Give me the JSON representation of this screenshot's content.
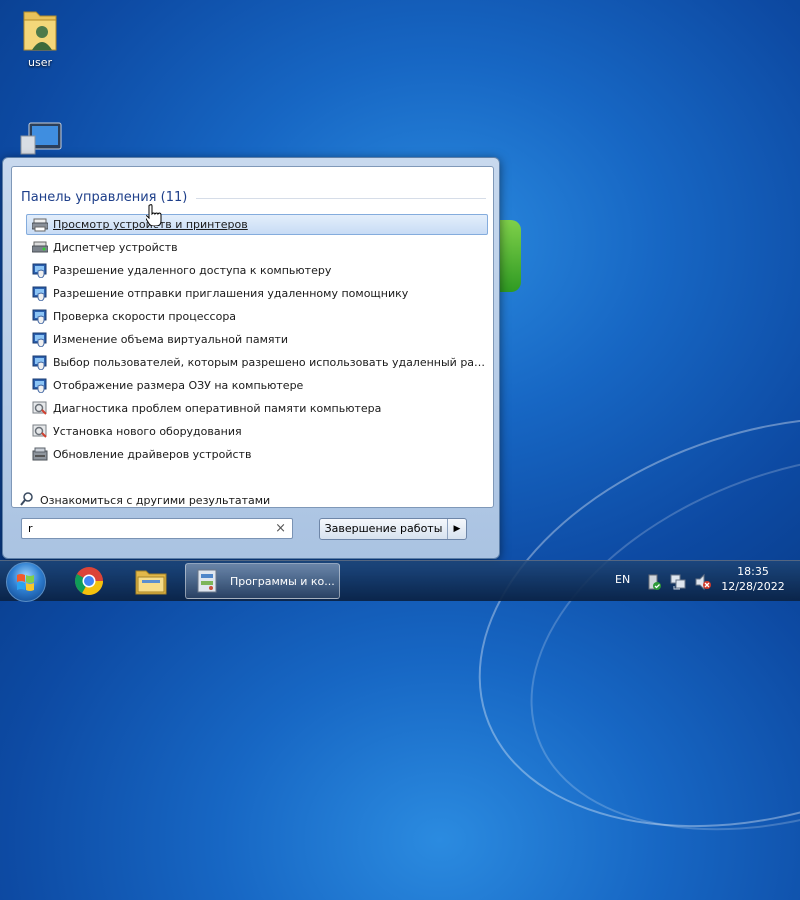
{
  "desktop": {
    "icons": [
      {
        "label": "user",
        "icon": "user-folder-icon"
      },
      {
        "label": "",
        "icon": "computer-icon"
      }
    ]
  },
  "start_menu": {
    "section_title": "Панель управления (11)",
    "items": [
      {
        "label": "Просмотр устройств и принтеров",
        "icon": "devices-printers-icon",
        "highlighted": true
      },
      {
        "label": "Диспетчер устройств",
        "icon": "device-manager-icon"
      },
      {
        "label": "Разрешение удаленного доступа к компьютеру",
        "icon": "system-shield-icon"
      },
      {
        "label": "Разрешение отправки приглашения удаленному помощнику",
        "icon": "system-shield-icon"
      },
      {
        "label": "Проверка скорости процессора",
        "icon": "system-shield-icon"
      },
      {
        "label": "Изменение объема виртуальной памяти",
        "icon": "system-shield-icon"
      },
      {
        "label": "Выбор пользователей, которым разрешено использовать удаленный рабоч...",
        "icon": "system-shield-icon"
      },
      {
        "label": "Отображение размера ОЗУ на компьютере",
        "icon": "system-shield-icon"
      },
      {
        "label": "Диагностика проблем оперативной памяти компьютера",
        "icon": "admin-tools-icon"
      },
      {
        "label": "Установка нового оборудования",
        "icon": "admin-tools-icon"
      },
      {
        "label": "Обновление драйверов устройств",
        "icon": "driver-update-icon"
      }
    ],
    "more_results": "Ознакомиться с другими результатами",
    "search": {
      "value": "r"
    },
    "shutdown_label": "Завершение работы"
  },
  "taskbar": {
    "pinned": [
      "chrome-icon",
      "explorer-icon"
    ],
    "active_task": {
      "label": "Программы и ко...",
      "icon": "control-panel-icon"
    },
    "tray": {
      "language": "EN",
      "time": "18:35",
      "date": "12/28/2022"
    }
  },
  "colors": {
    "accent": "#1e3f8a",
    "highlight": "#c8dcf5",
    "desktop": "#1767c4"
  }
}
